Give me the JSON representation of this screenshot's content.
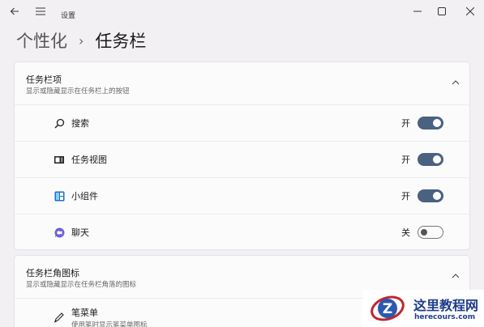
{
  "app": {
    "title": "设置"
  },
  "breadcrumb": {
    "parent": "个性化",
    "separator": "›",
    "current": "任务栏"
  },
  "window_controls": {
    "minimize": "—",
    "maximize": "☐",
    "close": "✕"
  },
  "section_taskbar_items": {
    "title": "任务栏项",
    "subtitle": "显示或隐藏显示在任务栏上的按钮",
    "items": [
      {
        "label": "搜索",
        "state": "开",
        "on": true,
        "icon": "search-icon"
      },
      {
        "label": "任务视图",
        "state": "开",
        "on": true,
        "icon": "task-view-icon"
      },
      {
        "label": "小组件",
        "state": "开",
        "on": true,
        "icon": "widgets-icon"
      },
      {
        "label": "聊天",
        "state": "关",
        "on": false,
        "icon": "chat-icon"
      }
    ]
  },
  "section_corner_icons": {
    "title": "任务栏角图标",
    "subtitle": "显示或隐藏显示在任务栏角落的图标",
    "items": [
      {
        "label": "笔菜单",
        "description": "使用笔时显示笔菜单图标",
        "icon": "pen-icon"
      }
    ]
  },
  "watermark": {
    "title": "这里教程网",
    "url": "herecours.com",
    "logo_letter": "Z"
  },
  "colors": {
    "toggle_on": "#4a6180",
    "background": "#f3f0f4",
    "card": "#fbfbfc"
  }
}
